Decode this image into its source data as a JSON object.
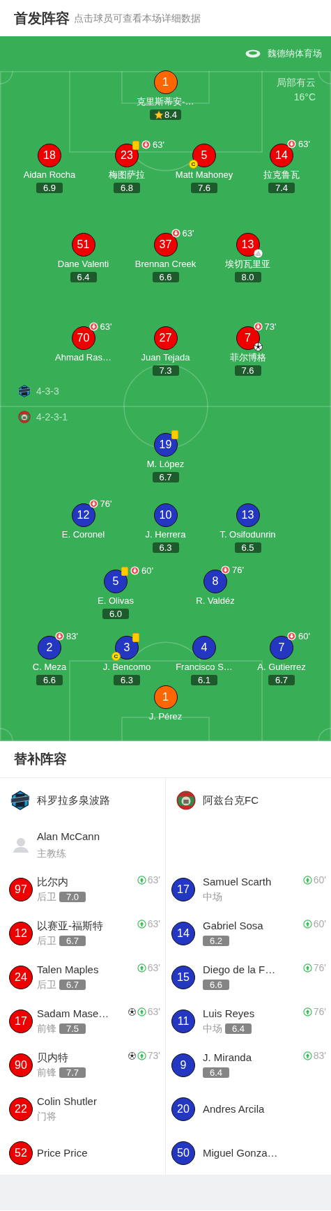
{
  "header": {
    "title": "首发阵容",
    "hint": "点击球员可查看本场详细数据"
  },
  "pitch": {
    "stadium": "魏德纳体育场",
    "weather": "局部有云",
    "temperature": "16°C"
  },
  "teams": [
    {
      "formation": "4-3-3",
      "lines": [
        [
          {
            "number": "1",
            "name": "克里斯蒂安-…",
            "rating": "8.4",
            "color": "#ff6600",
            "events": [
              {
                "kind": "best"
              }
            ]
          }
        ],
        [
          {
            "number": "18",
            "name": "Aidan Rocha",
            "rating": "6.9",
            "color": "#ee0000"
          },
          {
            "number": "23",
            "name": "梅图萨拉",
            "rating": "6.8",
            "color": "#ee0000",
            "events": [
              {
                "kind": "yellow_card"
              },
              {
                "kind": "sub_out",
                "minute": "63'"
              }
            ]
          },
          {
            "number": "5",
            "name": "Matt Mahoney",
            "rating": "7.6",
            "color": "#ee0000",
            "events": [
              {
                "kind": "captain",
                "label": "C"
              }
            ]
          },
          {
            "number": "14",
            "name": "拉克鲁瓦",
            "rating": "7.4",
            "color": "#ee0000",
            "events": [
              {
                "kind": "sub_out",
                "minute": "63'"
              }
            ]
          }
        ],
        [
          {
            "number": "51",
            "name": "Dane Valenti",
            "rating": "6.4",
            "color": "#ee0000"
          },
          {
            "number": "37",
            "name": "Brennan Creek",
            "rating": "6.6",
            "color": "#ee0000",
            "events": [
              {
                "kind": "sub_out",
                "minute": "63'"
              }
            ]
          },
          {
            "number": "13",
            "name": "埃切瓦里亚",
            "rating": "8.0",
            "color": "#ee0000",
            "events": [
              {
                "kind": "assist"
              }
            ]
          }
        ],
        [
          {
            "number": "70",
            "name": "Ahmad Ras…",
            "color": "#ee0000",
            "events": [
              {
                "kind": "sub_out",
                "minute": "63'"
              }
            ]
          },
          {
            "number": "27",
            "name": "Juan Tejada",
            "rating": "7.3",
            "color": "#ee0000"
          },
          {
            "number": "7",
            "name": "菲尔博格",
            "rating": "7.6",
            "color": "#ee0000",
            "events": [
              {
                "kind": "sub_out",
                "minute": "73'"
              },
              {
                "kind": "goal"
              }
            ]
          }
        ]
      ]
    },
    {
      "formation": "4-2-3-1",
      "lines": [
        [
          {
            "number": "19",
            "name": "M. López",
            "rating": "6.7",
            "color": "#2337c0",
            "events": [
              {
                "kind": "yellow_card"
              }
            ]
          }
        ],
        [
          {
            "number": "12",
            "name": "E. Coronel",
            "color": "#2337c0",
            "events": [
              {
                "kind": "sub_out",
                "minute": "76'"
              }
            ]
          },
          {
            "number": "10",
            "name": "J. Herrera",
            "rating": "6.3",
            "color": "#2337c0"
          },
          {
            "number": "13",
            "name": "T. Osifodunrin",
            "rating": "6.5",
            "color": "#2337c0"
          }
        ],
        [
          {
            "number": "5",
            "name": "E. Olivas",
            "rating": "6.0",
            "color": "#2337c0",
            "events": [
              {
                "kind": "yellow_card"
              },
              {
                "kind": "sub_out",
                "minute": "60'"
              }
            ]
          },
          {
            "number": "8",
            "name": "R. Valdéz",
            "color": "#2337c0",
            "events": [
              {
                "kind": "sub_out",
                "minute": "76'"
              }
            ]
          }
        ],
        [
          {
            "number": "2",
            "name": "C. Meza",
            "rating": "6.6",
            "color": "#2337c0",
            "events": [
              {
                "kind": "sub_out",
                "minute": "83'"
              }
            ]
          },
          {
            "number": "3",
            "name": "J. Bencomo",
            "rating": "6.3",
            "color": "#2337c0",
            "events": [
              {
                "kind": "yellow_card"
              },
              {
                "kind": "captain",
                "label": "C"
              }
            ]
          },
          {
            "number": "4",
            "name": "Francisco S…",
            "rating": "6.1",
            "color": "#2337c0"
          },
          {
            "number": "7",
            "name": "A. Gutierrez",
            "rating": "6.7",
            "color": "#2337c0",
            "events": [
              {
                "kind": "sub_out",
                "minute": "60'"
              }
            ]
          }
        ],
        [
          {
            "number": "1",
            "name": "J. Pérez",
            "color": "#ff6600"
          }
        ]
      ]
    }
  ],
  "substitutes": {
    "title": "替补阵容",
    "teams": [
      {
        "name": "科罗拉多泉波路",
        "color": "#ee0000",
        "coach": {
          "name": "Alan McCann",
          "role": "主教练"
        },
        "players": [
          {
            "number": "97",
            "name": "比尔内",
            "position": "后卫",
            "rating": "7.0",
            "events": [
              {
                "kind": "sub_in",
                "minute": "63'"
              }
            ]
          },
          {
            "number": "12",
            "name": "以赛亚-福斯特",
            "position": "后卫",
            "rating": "6.7",
            "events": [
              {
                "kind": "sub_in",
                "minute": "63'"
              }
            ]
          },
          {
            "number": "24",
            "name": "Talen Maples",
            "position": "后卫",
            "rating": "6.7",
            "events": [
              {
                "kind": "sub_in",
                "minute": "63'"
              }
            ]
          },
          {
            "number": "17",
            "name": "Sadam Mase…",
            "position": "前锋",
            "rating": "7.5",
            "events": [
              {
                "kind": "goal"
              },
              {
                "kind": "sub_in",
                "minute": "63'"
              }
            ]
          },
          {
            "number": "90",
            "name": "贝内特",
            "position": "前锋",
            "rating": "7.7",
            "events": [
              {
                "kind": "goal"
              },
              {
                "kind": "sub_in",
                "minute": "73'"
              }
            ]
          },
          {
            "number": "22",
            "name": "Colin Shutler",
            "position": "门将"
          },
          {
            "number": "52",
            "name": "Price Price"
          }
        ]
      },
      {
        "name": "阿兹台克FC",
        "color": "#2337c0",
        "players": [
          {
            "number": "17",
            "name": "Samuel Scarth",
            "position": "中场",
            "events": [
              {
                "kind": "sub_in",
                "minute": "60'"
              }
            ]
          },
          {
            "number": "14",
            "name": "Gabriel Sosa",
            "rating": "6.2",
            "events": [
              {
                "kind": "sub_in",
                "minute": "60'"
              }
            ]
          },
          {
            "number": "15",
            "name": "Diego de la F…",
            "rating": "6.6",
            "events": [
              {
                "kind": "sub_in",
                "minute": "76'"
              }
            ]
          },
          {
            "number": "11",
            "name": "Luis Reyes",
            "position": "中场",
            "rating": "6.4",
            "events": [
              {
                "kind": "sub_in",
                "minute": "76'"
              }
            ]
          },
          {
            "number": "9",
            "name": "J. Miranda",
            "rating": "6.4",
            "events": [
              {
                "kind": "sub_in",
                "minute": "83'"
              }
            ]
          },
          {
            "number": "20",
            "name": "Andres Arcila"
          },
          {
            "number": "50",
            "name": "Miguel Gonza…"
          }
        ]
      }
    ]
  }
}
